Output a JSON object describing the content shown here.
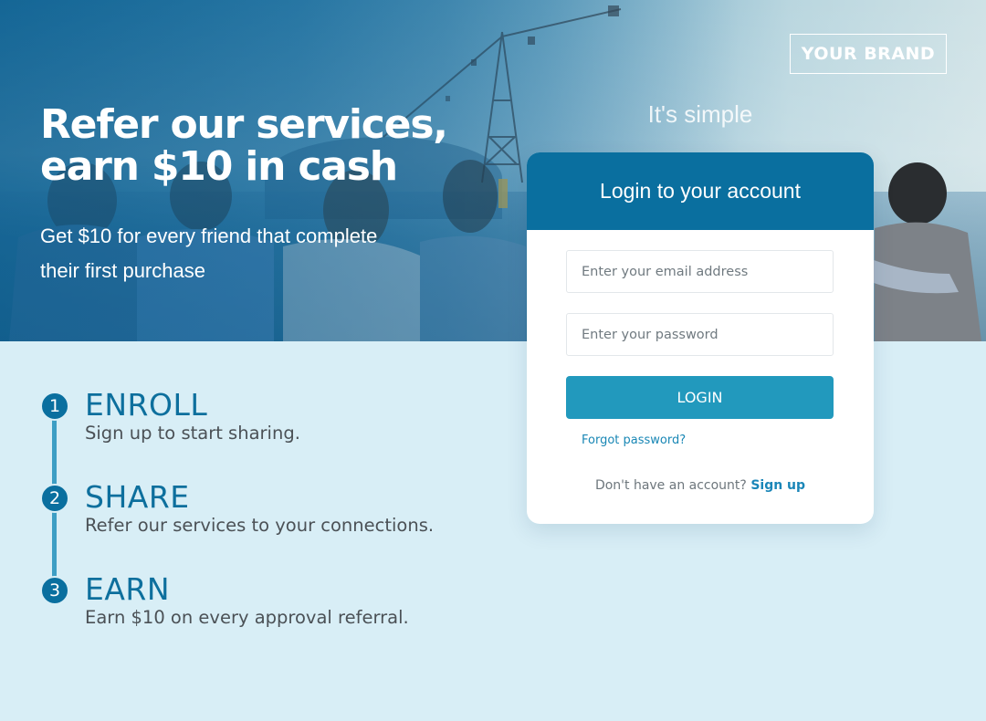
{
  "brand": {
    "label": "YOUR BRAND"
  },
  "hero": {
    "headline_line1": "Refer our services,",
    "headline_line2": "earn $10 in cash",
    "subline_line1": "Get $10 for every friend that complete",
    "subline_line2": "their first purchase",
    "tagline": "It's simple"
  },
  "login": {
    "title": "Login to your account",
    "email_placeholder": "Enter your email address",
    "password_placeholder": "Enter your password",
    "login_label": "LOGIN",
    "forgot_label": "Forgot password?",
    "no_account_text": "Don't have an account?",
    "signup_label": "Sign up"
  },
  "steps": [
    {
      "number": "1",
      "title": "ENROLL",
      "description": "Sign up to start sharing."
    },
    {
      "number": "2",
      "title": "SHARE",
      "description": "Refer our services to your connections."
    },
    {
      "number": "3",
      "title": "EARN",
      "description": "Earn $10 on every approval referral."
    }
  ],
  "colors": {
    "primary": "#0a6f9f",
    "button": "#2299bd",
    "background": "#d8eef6",
    "link": "#1987b5"
  }
}
